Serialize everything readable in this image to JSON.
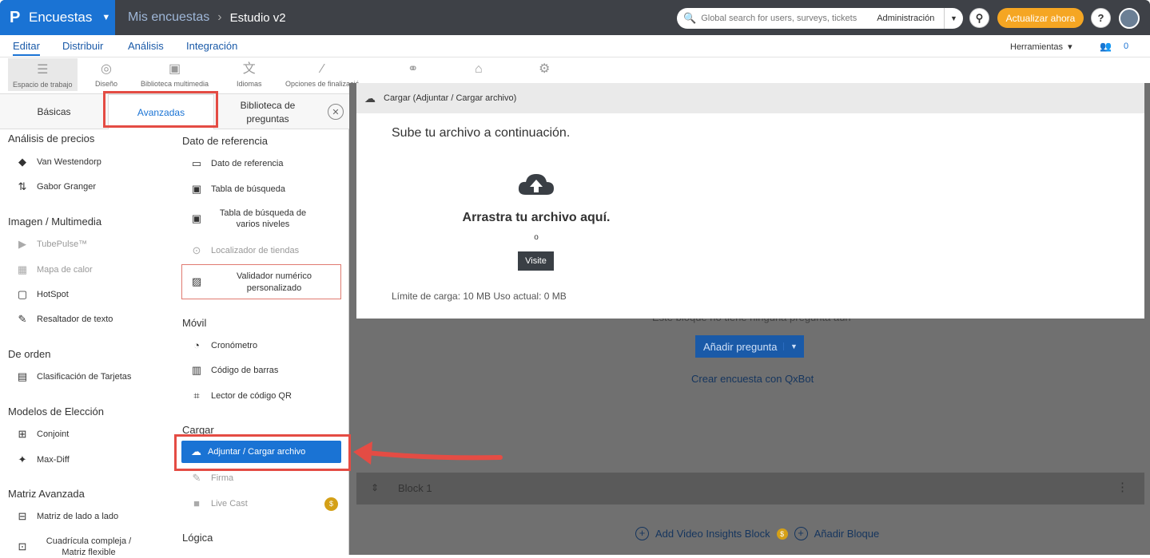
{
  "header": {
    "app_name": "Encuestas",
    "breadcrumb_parent": "Mis encuestas",
    "breadcrumb_sep": "›",
    "breadcrumb_current": "Estudio v2",
    "search_placeholder": "Global search for users, surveys, tickets",
    "search_scope": "Administración",
    "upgrade_label": "Actualizar ahora",
    "help_label": "?"
  },
  "nav": {
    "tabs": [
      "Editar",
      "Distribuir",
      "Análisis",
      "Integración"
    ],
    "tools_label": "Herramientas",
    "collaborators_count": "0"
  },
  "toolbar": {
    "items": [
      "Espacio de trabajo",
      "Diseño",
      "Biblioteca multimedia",
      "Idiomas",
      "Opciones de finalizació"
    ]
  },
  "panel": {
    "tabs": [
      "Básicas",
      "Avanzadas"
    ],
    "tab3_line1": "Biblioteca de",
    "tab3_line2": "preguntas",
    "left_col": {
      "sections": [
        {
          "title": "Análisis de precios",
          "items": [
            "Van Westendorp",
            "Gabor Granger"
          ]
        },
        {
          "title": "Imagen / Multimedia",
          "items": [
            "TubePulse™",
            "Mapa de calor",
            "HotSpot",
            "Resaltador de texto"
          ]
        },
        {
          "title": "De orden",
          "items": [
            "Clasificación de Tarjetas"
          ]
        },
        {
          "title": "Modelos de Elección",
          "items": [
            "Conjoint",
            "Max-Diff"
          ]
        },
        {
          "title": "Matriz Avanzada",
          "items": [
            "Matriz de lado a lado"
          ]
        }
      ],
      "last_item_line1": "Cuadrícula compleja /",
      "last_item_line2": "Matriz flexible"
    },
    "right_col": {
      "section1_title": "Dato de referencia",
      "section1_items": [
        "Dato de referencia",
        "Tabla de búsqueda"
      ],
      "multilevel_line1": "Tabla de búsqueda de",
      "multilevel_line2": "varios niveles",
      "store_locator": "Localizador de tiendas",
      "custom_validator_line1": "Validador numérico",
      "custom_validator_line2": "personalizado",
      "section2_title": "Móvil",
      "section2_items": [
        "Cronómetro",
        "Código de barras",
        "Lector de código QR"
      ],
      "section3_title": "Cargar",
      "upload_label": "Adjuntar / Cargar archivo",
      "signature": "Firma",
      "livecast": "Live Cast",
      "section4_title": "Lógica"
    }
  },
  "modal": {
    "header": "Cargar (Adjuntar / Cargar archivo)",
    "title": "Sube tu archivo a continuación.",
    "drag_text": "Arrastra tu archivo aquí.",
    "or_text": "o",
    "visit_button": "Visite",
    "limit_text": "Límite de carga: 10 MB Uso actual: 0 MB"
  },
  "canvas": {
    "empty_block_text": "Este bloque no tiene ninguna pregunta aún",
    "add_question": "Añadir pregunta",
    "qxbot_link": "Crear encuesta con QxBot",
    "block_name": "Block 1",
    "add_video_block": "Add Video Insights Block",
    "add_block": "Añadir Bloque"
  },
  "colors": {
    "brand_blue": "#1a73d4",
    "topbar": "#3e4147",
    "upgrade_orange": "#f5a623",
    "highlight_red": "#e44c44"
  }
}
